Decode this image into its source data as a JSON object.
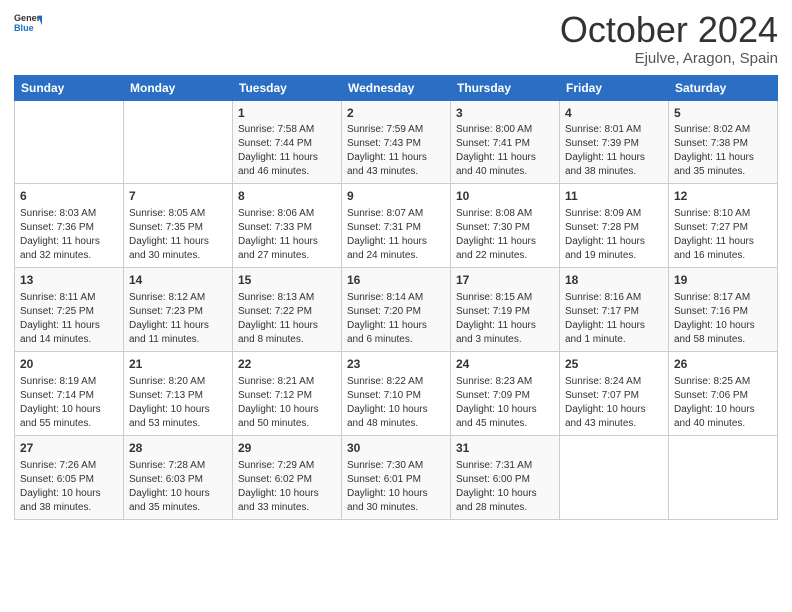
{
  "header": {
    "logo_general": "General",
    "logo_blue": "Blue",
    "title": "October 2024",
    "subtitle": "Ejulve, Aragon, Spain"
  },
  "weekdays": [
    "Sunday",
    "Monday",
    "Tuesday",
    "Wednesday",
    "Thursday",
    "Friday",
    "Saturday"
  ],
  "weeks": [
    [
      {
        "day": null,
        "sunrise": null,
        "sunset": null,
        "daylight": null
      },
      {
        "day": null,
        "sunrise": null,
        "sunset": null,
        "daylight": null
      },
      {
        "day": "1",
        "sunrise": "Sunrise: 7:58 AM",
        "sunset": "Sunset: 7:44 PM",
        "daylight": "Daylight: 11 hours and 46 minutes."
      },
      {
        "day": "2",
        "sunrise": "Sunrise: 7:59 AM",
        "sunset": "Sunset: 7:43 PM",
        "daylight": "Daylight: 11 hours and 43 minutes."
      },
      {
        "day": "3",
        "sunrise": "Sunrise: 8:00 AM",
        "sunset": "Sunset: 7:41 PM",
        "daylight": "Daylight: 11 hours and 40 minutes."
      },
      {
        "day": "4",
        "sunrise": "Sunrise: 8:01 AM",
        "sunset": "Sunset: 7:39 PM",
        "daylight": "Daylight: 11 hours and 38 minutes."
      },
      {
        "day": "5",
        "sunrise": "Sunrise: 8:02 AM",
        "sunset": "Sunset: 7:38 PM",
        "daylight": "Daylight: 11 hours and 35 minutes."
      }
    ],
    [
      {
        "day": "6",
        "sunrise": "Sunrise: 8:03 AM",
        "sunset": "Sunset: 7:36 PM",
        "daylight": "Daylight: 11 hours and 32 minutes."
      },
      {
        "day": "7",
        "sunrise": "Sunrise: 8:05 AM",
        "sunset": "Sunset: 7:35 PM",
        "daylight": "Daylight: 11 hours and 30 minutes."
      },
      {
        "day": "8",
        "sunrise": "Sunrise: 8:06 AM",
        "sunset": "Sunset: 7:33 PM",
        "daylight": "Daylight: 11 hours and 27 minutes."
      },
      {
        "day": "9",
        "sunrise": "Sunrise: 8:07 AM",
        "sunset": "Sunset: 7:31 PM",
        "daylight": "Daylight: 11 hours and 24 minutes."
      },
      {
        "day": "10",
        "sunrise": "Sunrise: 8:08 AM",
        "sunset": "Sunset: 7:30 PM",
        "daylight": "Daylight: 11 hours and 22 minutes."
      },
      {
        "day": "11",
        "sunrise": "Sunrise: 8:09 AM",
        "sunset": "Sunset: 7:28 PM",
        "daylight": "Daylight: 11 hours and 19 minutes."
      },
      {
        "day": "12",
        "sunrise": "Sunrise: 8:10 AM",
        "sunset": "Sunset: 7:27 PM",
        "daylight": "Daylight: 11 hours and 16 minutes."
      }
    ],
    [
      {
        "day": "13",
        "sunrise": "Sunrise: 8:11 AM",
        "sunset": "Sunset: 7:25 PM",
        "daylight": "Daylight: 11 hours and 14 minutes."
      },
      {
        "day": "14",
        "sunrise": "Sunrise: 8:12 AM",
        "sunset": "Sunset: 7:23 PM",
        "daylight": "Daylight: 11 hours and 11 minutes."
      },
      {
        "day": "15",
        "sunrise": "Sunrise: 8:13 AM",
        "sunset": "Sunset: 7:22 PM",
        "daylight": "Daylight: 11 hours and 8 minutes."
      },
      {
        "day": "16",
        "sunrise": "Sunrise: 8:14 AM",
        "sunset": "Sunset: 7:20 PM",
        "daylight": "Daylight: 11 hours and 6 minutes."
      },
      {
        "day": "17",
        "sunrise": "Sunrise: 8:15 AM",
        "sunset": "Sunset: 7:19 PM",
        "daylight": "Daylight: 11 hours and 3 minutes."
      },
      {
        "day": "18",
        "sunrise": "Sunrise: 8:16 AM",
        "sunset": "Sunset: 7:17 PM",
        "daylight": "Daylight: 11 hours and 1 minute."
      },
      {
        "day": "19",
        "sunrise": "Sunrise: 8:17 AM",
        "sunset": "Sunset: 7:16 PM",
        "daylight": "Daylight: 10 hours and 58 minutes."
      }
    ],
    [
      {
        "day": "20",
        "sunrise": "Sunrise: 8:19 AM",
        "sunset": "Sunset: 7:14 PM",
        "daylight": "Daylight: 10 hours and 55 minutes."
      },
      {
        "day": "21",
        "sunrise": "Sunrise: 8:20 AM",
        "sunset": "Sunset: 7:13 PM",
        "daylight": "Daylight: 10 hours and 53 minutes."
      },
      {
        "day": "22",
        "sunrise": "Sunrise: 8:21 AM",
        "sunset": "Sunset: 7:12 PM",
        "daylight": "Daylight: 10 hours and 50 minutes."
      },
      {
        "day": "23",
        "sunrise": "Sunrise: 8:22 AM",
        "sunset": "Sunset: 7:10 PM",
        "daylight": "Daylight: 10 hours and 48 minutes."
      },
      {
        "day": "24",
        "sunrise": "Sunrise: 8:23 AM",
        "sunset": "Sunset: 7:09 PM",
        "daylight": "Daylight: 10 hours and 45 minutes."
      },
      {
        "day": "25",
        "sunrise": "Sunrise: 8:24 AM",
        "sunset": "Sunset: 7:07 PM",
        "daylight": "Daylight: 10 hours and 43 minutes."
      },
      {
        "day": "26",
        "sunrise": "Sunrise: 8:25 AM",
        "sunset": "Sunset: 7:06 PM",
        "daylight": "Daylight: 10 hours and 40 minutes."
      }
    ],
    [
      {
        "day": "27",
        "sunrise": "Sunrise: 7:26 AM",
        "sunset": "Sunset: 6:05 PM",
        "daylight": "Daylight: 10 hours and 38 minutes."
      },
      {
        "day": "28",
        "sunrise": "Sunrise: 7:28 AM",
        "sunset": "Sunset: 6:03 PM",
        "daylight": "Daylight: 10 hours and 35 minutes."
      },
      {
        "day": "29",
        "sunrise": "Sunrise: 7:29 AM",
        "sunset": "Sunset: 6:02 PM",
        "daylight": "Daylight: 10 hours and 33 minutes."
      },
      {
        "day": "30",
        "sunrise": "Sunrise: 7:30 AM",
        "sunset": "Sunset: 6:01 PM",
        "daylight": "Daylight: 10 hours and 30 minutes."
      },
      {
        "day": "31",
        "sunrise": "Sunrise: 7:31 AM",
        "sunset": "Sunset: 6:00 PM",
        "daylight": "Daylight: 10 hours and 28 minutes."
      },
      {
        "day": null,
        "sunrise": null,
        "sunset": null,
        "daylight": null
      },
      {
        "day": null,
        "sunrise": null,
        "sunset": null,
        "daylight": null
      }
    ]
  ]
}
